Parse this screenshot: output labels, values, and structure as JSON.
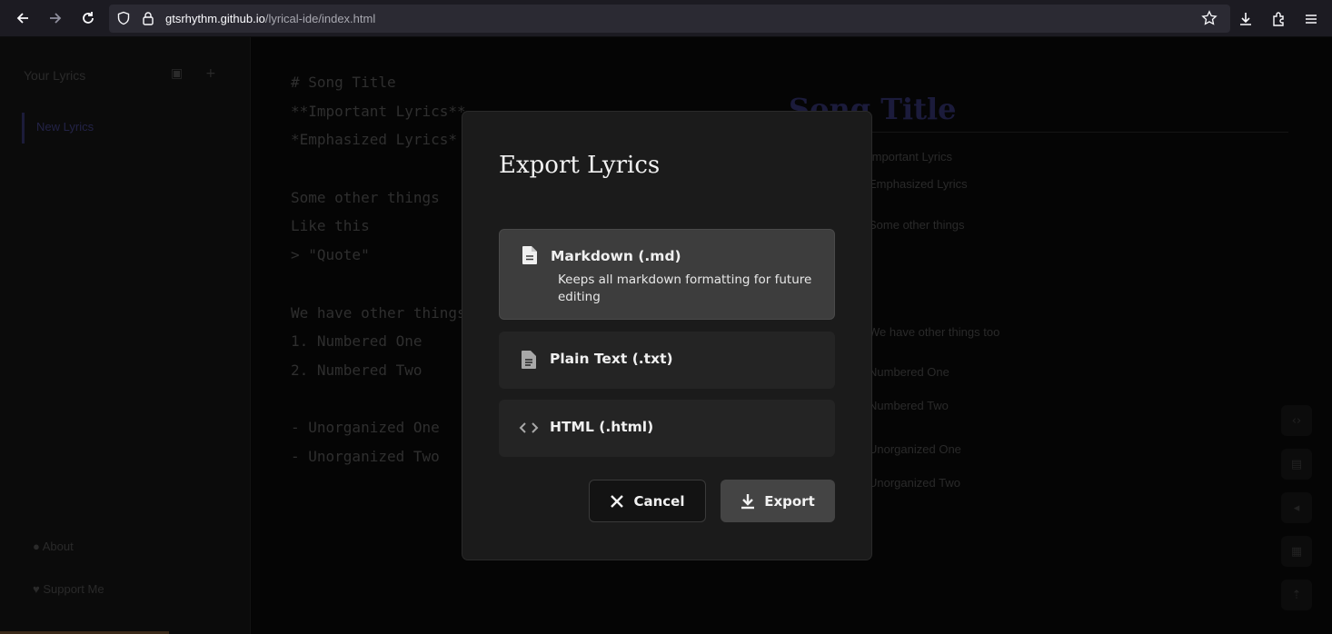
{
  "browser": {
    "url_host": "gtsrhythm.github.io",
    "url_path": "/lyrical-ide/index.html"
  },
  "app": {
    "sidebar": {
      "title": "Your Lyrics",
      "items": [
        "New Lyrics"
      ],
      "footer": [
        "About",
        "Support Me"
      ]
    },
    "editor_lines": [
      "# Song Title",
      "**Important Lyrics**",
      "*Emphasized Lyrics*",
      "",
      "Some other things",
      "Like this",
      "> \"Quote\"",
      "",
      "We have other things too",
      "1. Numbered One",
      "2. Numbered Two",
      "",
      "- Unorganized One",
      "- Unorganized Two"
    ],
    "preview": {
      "title": "Song Title",
      "lines": [
        "Important Lyrics",
        "Emphasized Lyrics",
        "Some other things",
        "We have other things too",
        "Numbered One",
        "Numbered Two",
        "Unorganized One",
        "Unorganized Two"
      ]
    }
  },
  "modal": {
    "title": "Export Lyrics",
    "options": [
      {
        "label": "Markdown (.md)",
        "description": "Keeps all markdown formatting for future editing",
        "icon": "file-document-icon",
        "selected": true
      },
      {
        "label": "Plain Text (.txt)",
        "icon": "file-text-icon",
        "selected": false
      },
      {
        "label": "HTML (.html)",
        "icon": "code-icon",
        "selected": false
      }
    ],
    "cancel_label": "Cancel",
    "export_label": "Export"
  }
}
